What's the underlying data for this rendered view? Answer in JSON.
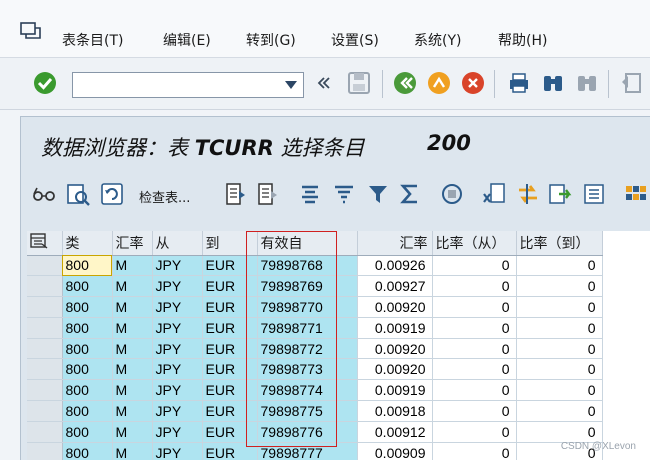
{
  "menu": {
    "items": [
      "表条目(T)",
      "编辑(E)",
      "转到(G)",
      "设置(S)",
      "系统(Y)",
      "帮助(H)"
    ]
  },
  "toolbar": {
    "command_value": ""
  },
  "screen": {
    "title": "数据浏览器：表",
    "table_name": "TCURR",
    "title_suffix": "选择条目",
    "entry_count": "200"
  },
  "app_toolbar": {
    "check_table_label": "检查表..."
  },
  "grid": {
    "columns": [
      "类",
      "汇率",
      "从",
      "到",
      "有效自",
      "汇率",
      "比率（从）",
      "比率（到）"
    ],
    "rows": [
      [
        "800",
        "M",
        "JPY",
        "EUR",
        "79898768",
        "0.00926",
        "0",
        "0"
      ],
      [
        "800",
        "M",
        "JPY",
        "EUR",
        "79898769",
        "0.00927",
        "0",
        "0"
      ],
      [
        "800",
        "M",
        "JPY",
        "EUR",
        "79898770",
        "0.00920",
        "0",
        "0"
      ],
      [
        "800",
        "M",
        "JPY",
        "EUR",
        "79898771",
        "0.00919",
        "0",
        "0"
      ],
      [
        "800",
        "M",
        "JPY",
        "EUR",
        "79898772",
        "0.00920",
        "0",
        "0"
      ],
      [
        "800",
        "M",
        "JPY",
        "EUR",
        "79898773",
        "0.00920",
        "0",
        "0"
      ],
      [
        "800",
        "M",
        "JPY",
        "EUR",
        "79898774",
        "0.00919",
        "0",
        "0"
      ],
      [
        "800",
        "M",
        "JPY",
        "EUR",
        "79898775",
        "0.00918",
        "0",
        "0"
      ],
      [
        "800",
        "M",
        "JPY",
        "EUR",
        "79898776",
        "0.00912",
        "0",
        "0"
      ],
      [
        "800",
        "M",
        "JPY",
        "EUR",
        "79898777",
        "0.00909",
        "0",
        "0"
      ]
    ]
  },
  "watermark": "CSDN @XLevon",
  "colors": {
    "key_cell": "#aee4f1",
    "highlight_box": "#d02020",
    "ok_green": "#3a9a2e"
  }
}
